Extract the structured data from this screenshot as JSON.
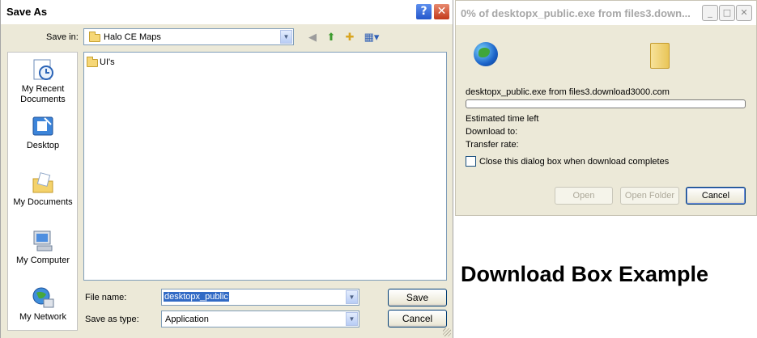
{
  "save_as": {
    "title": "Save As",
    "save_in_label": "Save in:",
    "save_in_value": "Halo CE Maps",
    "places": [
      {
        "label": "My Recent Documents",
        "icon": "recent-documents-icon"
      },
      {
        "label": "Desktop",
        "icon": "desktop-icon"
      },
      {
        "label": "My Documents",
        "icon": "my-documents-icon"
      },
      {
        "label": "My Computer",
        "icon": "my-computer-icon"
      },
      {
        "label": "My Network",
        "icon": "my-network-icon"
      }
    ],
    "files": [
      {
        "name": "UI's",
        "type": "folder"
      }
    ],
    "file_name_label": "File name:",
    "file_name_value": "desktopx_public",
    "save_as_type_label": "Save as type:",
    "save_as_type_value": "Application",
    "save_button": "Save",
    "cancel_button": "Cancel"
  },
  "download": {
    "title": "0% of desktopx_public.exe from files3.down...",
    "progress_percent": 0,
    "file_line": "desktopx_public.exe from files3.download3000.com",
    "estimated_time_left_label": "Estimated time left",
    "download_to_label": "Download to:",
    "transfer_rate_label": "Transfer rate:",
    "close_when_complete_label": "Close this dialog box when download completes",
    "close_when_complete_checked": false,
    "open_button": "Open",
    "open_folder_button": "Open Folder",
    "cancel_button": "Cancel"
  },
  "caption": "Download Box Example",
  "colors": {
    "xp_title_blue": "#2457cb",
    "close_red": "#c2391b",
    "dialog_bg": "#ece9d8",
    "selection": "#316ac5"
  }
}
